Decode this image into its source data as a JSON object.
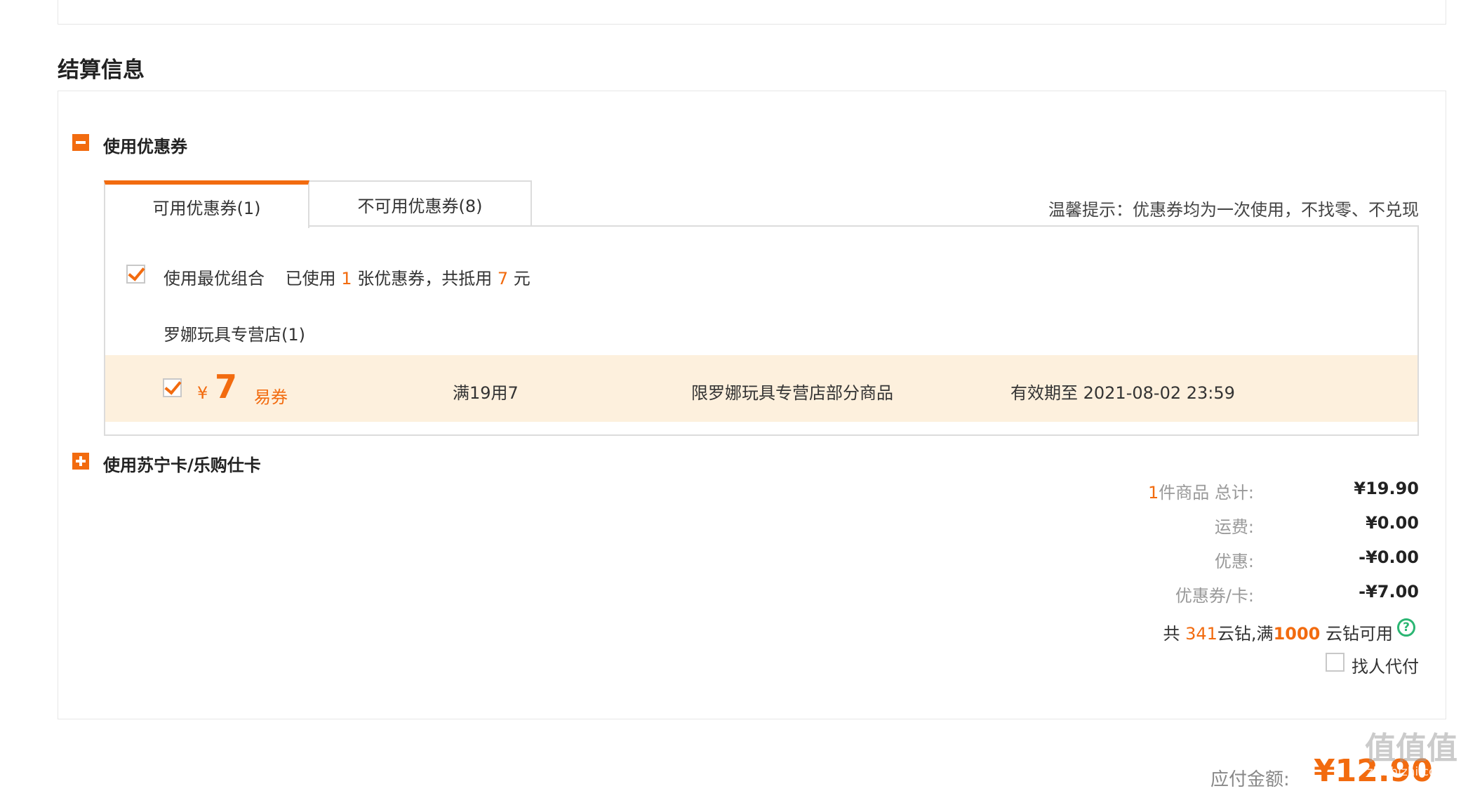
{
  "section_title": "结算信息",
  "coupon_section": {
    "label": "使用优惠券",
    "tabs": [
      {
        "label": "可用优惠券(1)"
      },
      {
        "label": "不可用优惠券(8)"
      }
    ],
    "tip": "温馨提示：优惠券均为一次使用，不找零、不兑现",
    "best_combo": {
      "label": "使用最优组合",
      "used_prefix": "已使用",
      "used_count": "1",
      "used_mid": "张优惠券，共抵用",
      "used_amount": "7",
      "used_suffix": "元"
    },
    "store_name": "罗娜玩具专营店(1)",
    "coupon": {
      "currency": "¥",
      "amount": "7",
      "type": "易券",
      "condition": "满19用7",
      "scope": "限罗娜玩具专营店部分商品",
      "validity": "有效期至 2021-08-02 23:59"
    }
  },
  "card_section": {
    "label": "使用苏宁卡/乐购仕卡"
  },
  "summary": {
    "items_count": "1",
    "items_label": "件商品 总计:",
    "items_total": "¥19.90",
    "shipping_label": "运费:",
    "shipping_value": "¥0.00",
    "discount_label": "优惠:",
    "discount_value": "-¥0.00",
    "coupon_label": "优惠券/卡:",
    "coupon_value": "-¥7.00",
    "diamonds_prefix": "共",
    "diamonds_count": "341",
    "diamonds_mid": "云钻,满",
    "diamonds_threshold": "1000",
    "diamonds_suffix": "云钻可用",
    "help_icon": "?",
    "pay_for_me": "找人代付"
  },
  "payable": {
    "label": "应付金额:",
    "amount": "¥12.90"
  },
  "watermark": {
    "line1": "值值值",
    "line2": "zhizhizhi.com"
  }
}
